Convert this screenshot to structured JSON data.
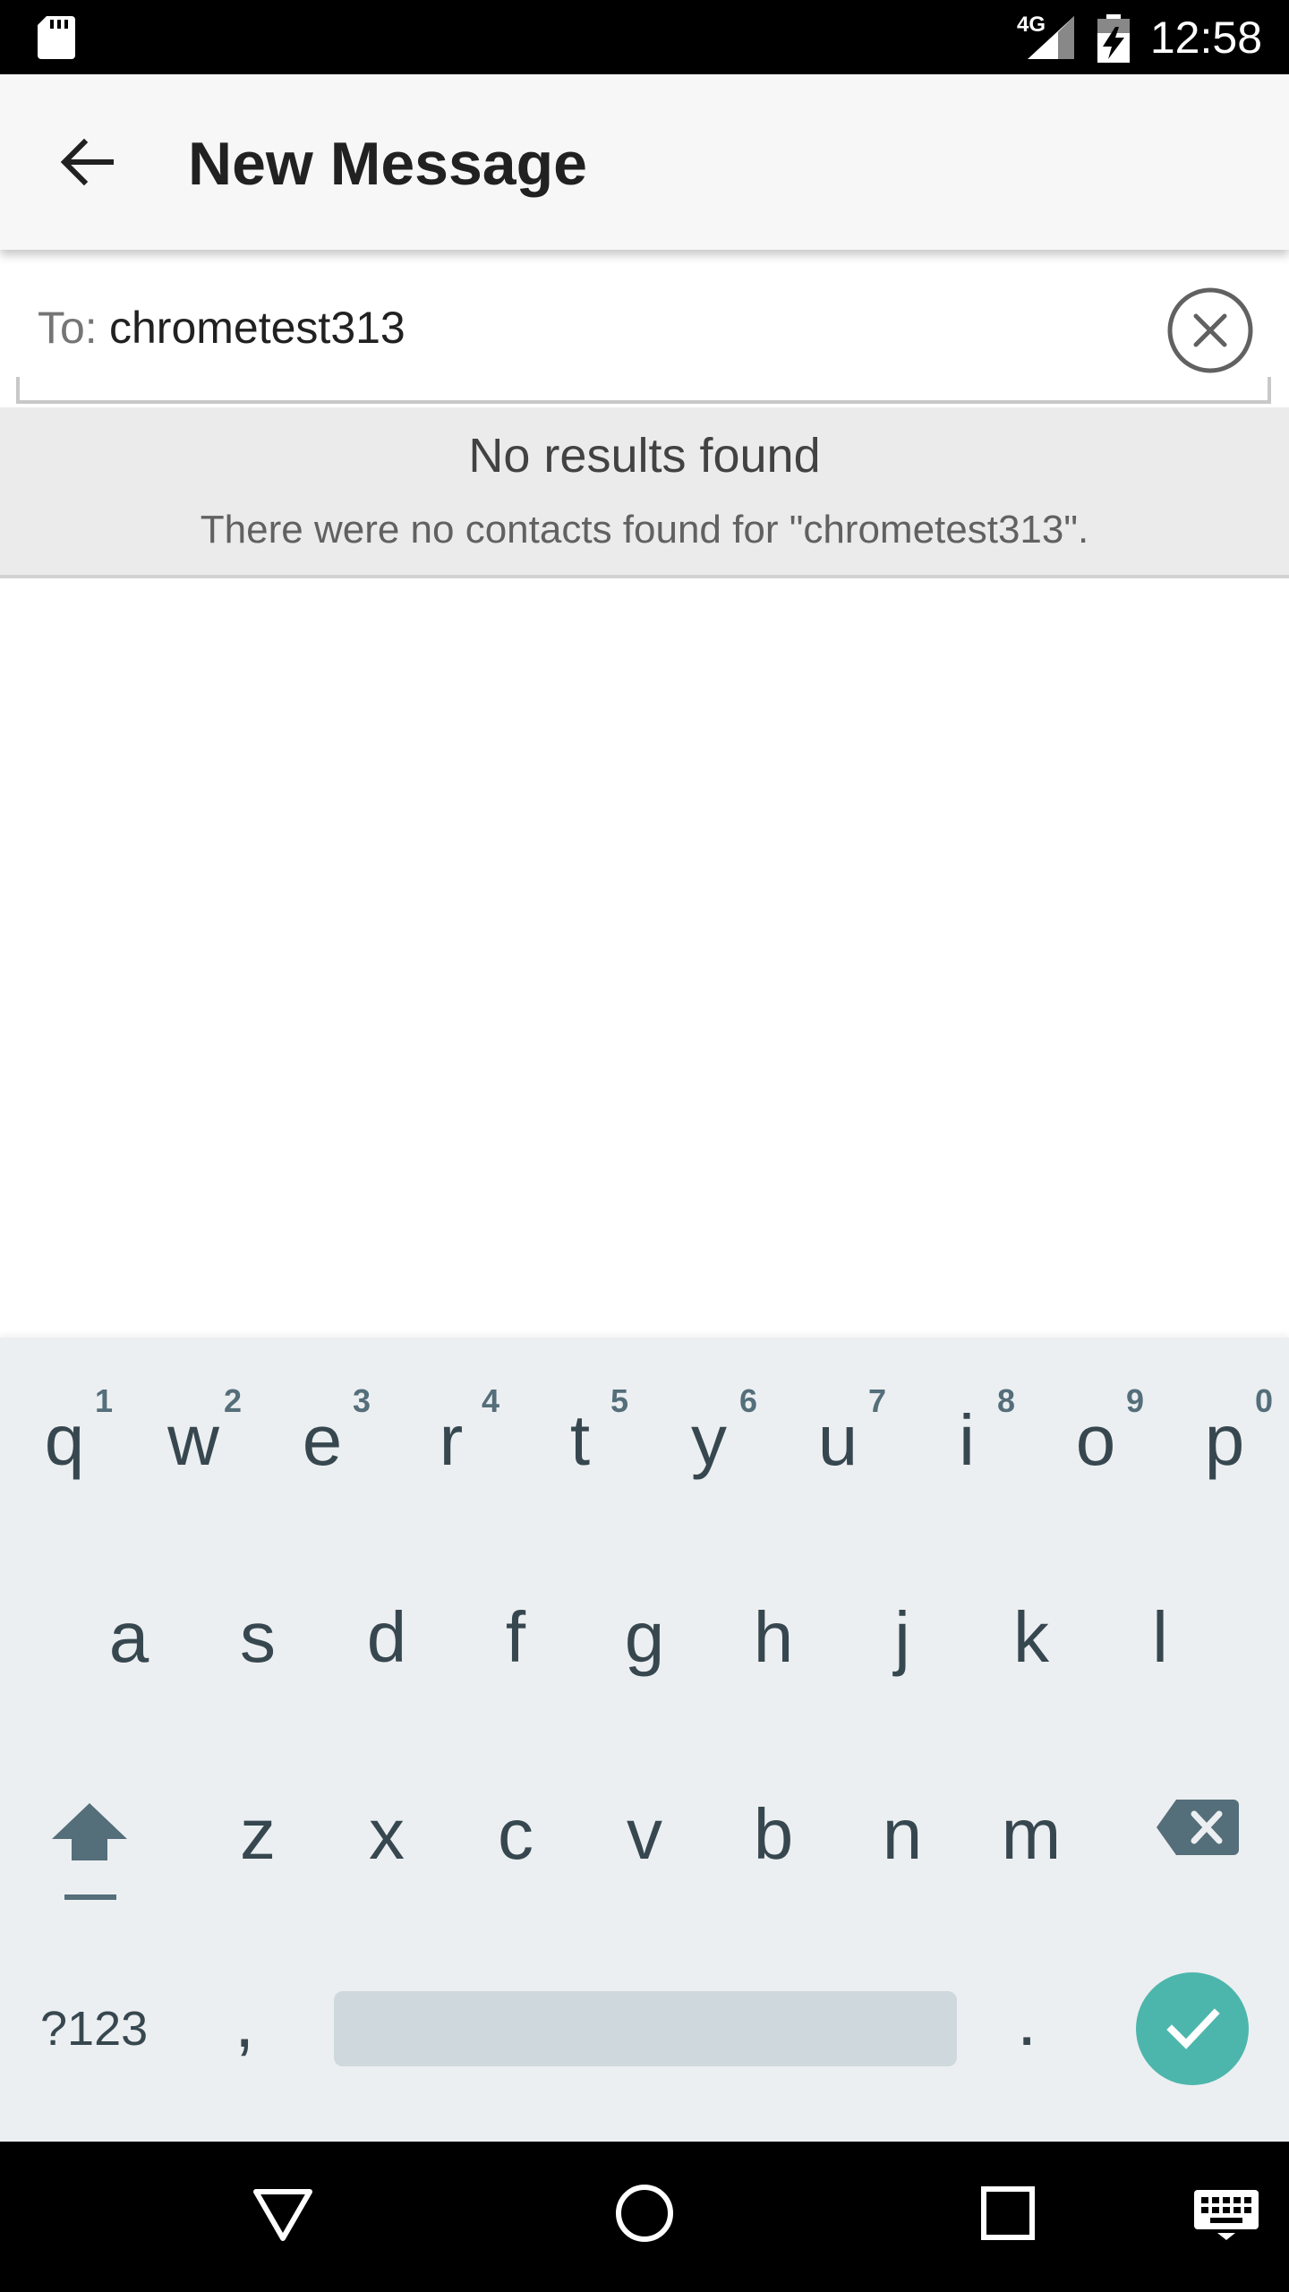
{
  "status_bar": {
    "time": "12:58",
    "network": "4G",
    "icons": [
      "sd-card-icon",
      "signal-icon",
      "battery-charging-icon"
    ]
  },
  "app_bar": {
    "title": "New Message",
    "back_icon": "arrow-back-icon"
  },
  "recipient": {
    "prefix": "To:",
    "value": "chrometest313",
    "clear_icon": "clear-circle-icon"
  },
  "results": {
    "title": "No results found",
    "description": "There were no contacts found for \"chrometest313\"."
  },
  "keyboard": {
    "row1": [
      {
        "key": "q",
        "hint": "1"
      },
      {
        "key": "w",
        "hint": "2"
      },
      {
        "key": "e",
        "hint": "3"
      },
      {
        "key": "r",
        "hint": "4"
      },
      {
        "key": "t",
        "hint": "5"
      },
      {
        "key": "y",
        "hint": "6"
      },
      {
        "key": "u",
        "hint": "7"
      },
      {
        "key": "i",
        "hint": "8"
      },
      {
        "key": "o",
        "hint": "9"
      },
      {
        "key": "p",
        "hint": "0"
      }
    ],
    "row2": [
      "a",
      "s",
      "d",
      "f",
      "g",
      "h",
      "j",
      "k",
      "l"
    ],
    "row3": [
      "z",
      "x",
      "c",
      "v",
      "b",
      "n",
      "m"
    ],
    "symbols_label": "?123",
    "comma": ",",
    "period": ".",
    "enter_icon": "check-icon",
    "shift_icon": "shift-icon",
    "backspace_icon": "backspace-icon"
  },
  "nav_bar": {
    "icons": [
      "back-triangle-icon",
      "home-circle-icon",
      "recents-square-icon",
      "keyboard-icon"
    ]
  },
  "colors": {
    "accent": "#4db6ac",
    "keyboard_bg": "#eceff1",
    "status_bar": "#000000"
  }
}
